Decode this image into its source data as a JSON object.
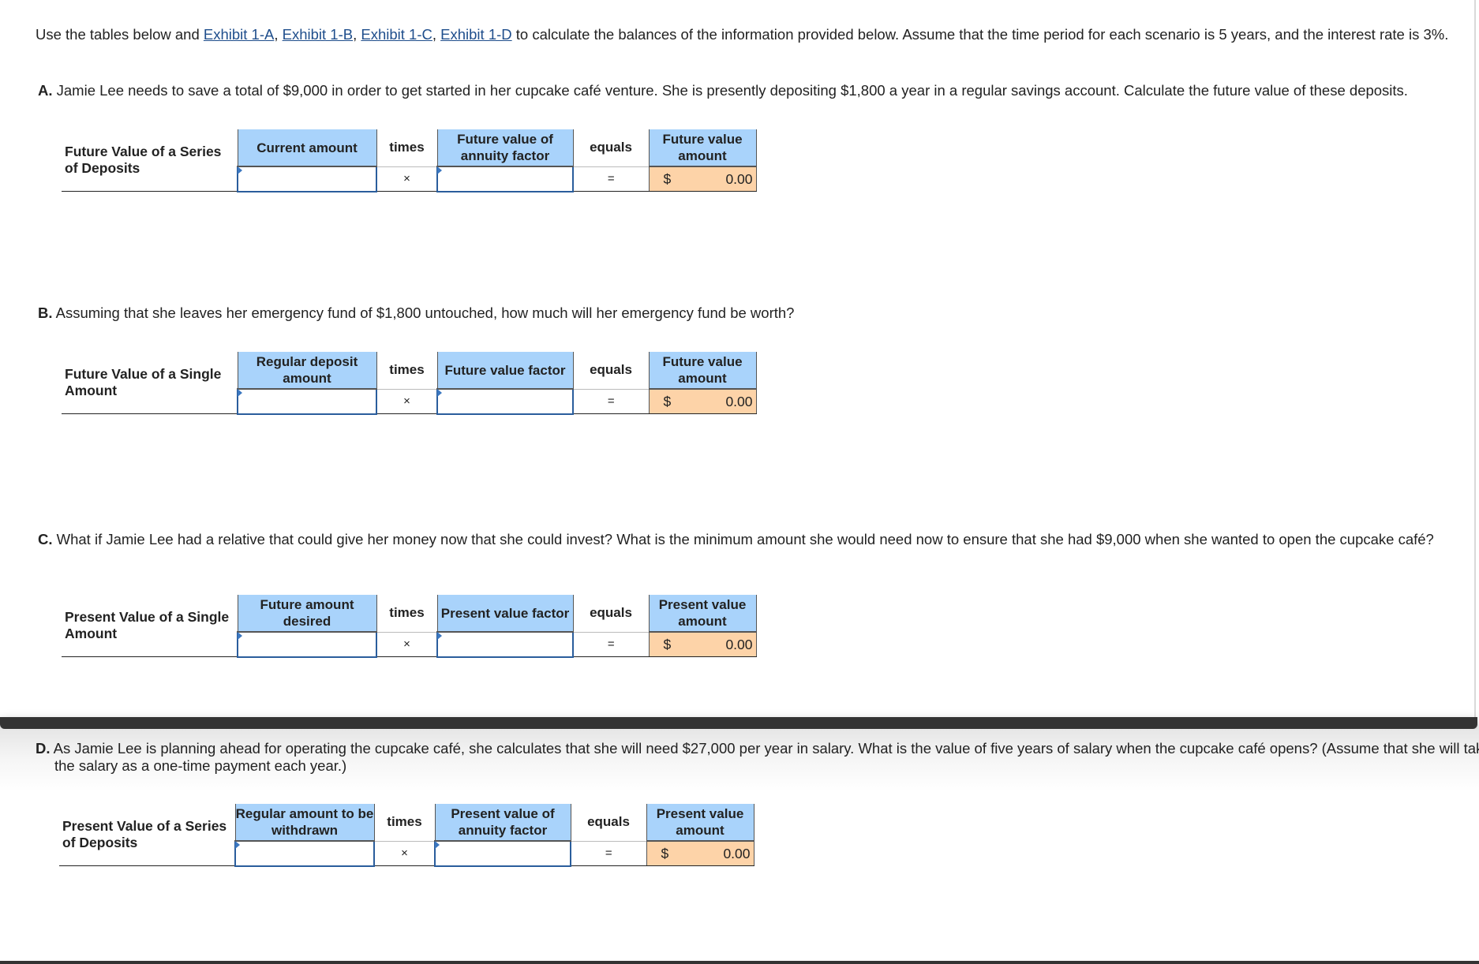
{
  "intro": {
    "prefix": "Use the tables below and ",
    "links": [
      "Exhibit 1-A",
      "Exhibit 1-B",
      "Exhibit 1-C",
      "Exhibit 1-D"
    ],
    "suffix": " to calculate the balances of the information provided below. Assume that the time period for each scenario is 5 years, and the interest rate is 3%."
  },
  "sections": [
    {
      "letter": "A.",
      "question": " Jamie Lee needs to save a total of $9,000 in order to get started in her cupcake café venture. She is presently depositing $1,800 a year in a regular savings account. Calculate the future value of these deposits.",
      "table": {
        "label": "Future Value of a Series of Deposits",
        "col1": "Current amount",
        "times": "times",
        "col3": "Future value of annuity factor",
        "equals": "equals",
        "result_header": "Future value amount",
        "times_symbol": "×",
        "equals_symbol": "=",
        "input1": "",
        "input2": "",
        "currency": "$",
        "result": "0.00"
      }
    },
    {
      "letter": "B.",
      "question": " Assuming that she leaves her emergency fund of $1,800 untouched, how much will her emergency fund be worth?",
      "table": {
        "label": "Future Value of a Single Amount",
        "col1": "Regular deposit amount",
        "times": "times",
        "col3": "Future value factor",
        "equals": "equals",
        "result_header": "Future value amount",
        "times_symbol": "×",
        "equals_symbol": "=",
        "input1": "",
        "input2": "",
        "currency": "$",
        "result": "0.00"
      }
    },
    {
      "letter": "C.",
      "question": " What if Jamie Lee had a relative that could give her money now that she could invest? What is the minimum amount she would need now to ensure that she had $9,000 when she wanted to open the cupcake café?",
      "table": {
        "label": "Present Value of a Single Amount",
        "col1": "Future amount desired",
        "times": "times",
        "col3": "Present value factor",
        "equals": "equals",
        "result_header": "Present value amount",
        "times_symbol": "×",
        "equals_symbol": "=",
        "input1": "",
        "input2": "",
        "currency": "$",
        "result": "0.00"
      }
    },
    {
      "letter": "D.",
      "question": " As Jamie Lee is planning ahead for operating the cupcake café, she calculates that she will need $27,000 per year in salary. What is the value of five years of salary when the cupcake café opens? (Assume that she will take the salary as a one-time payment each year.)",
      "table": {
        "label": "Present Value of a Series of Deposits",
        "col1": "Regular amount to be withdrawn",
        "times": "times",
        "col3": "Present value of annuity factor",
        "equals": "equals",
        "result_header": "Present value amount",
        "times_symbol": "×",
        "equals_symbol": "=",
        "input1": "",
        "input2": "",
        "currency": "$",
        "result": "0.00"
      }
    }
  ],
  "colors": {
    "header_bg": "#a9d3fb",
    "result_bg": "#fdd3a8",
    "input_border": "#2a5d9c",
    "link": "#1f4e8c"
  }
}
